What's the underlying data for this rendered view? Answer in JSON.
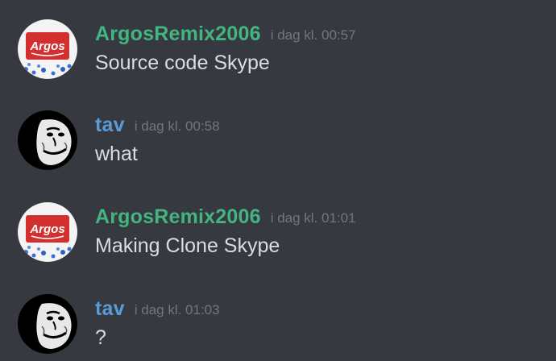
{
  "messages": [
    {
      "author": "ArgosRemix2006",
      "avatar_icon": "argos-logo-avatar",
      "avatar_text": "Argos",
      "name_color": "#43b581",
      "timestamp": "i dag kl. 00:57",
      "text": "Source code Skype"
    },
    {
      "author": "tav",
      "avatar_icon": "troll-face-avatar",
      "name_color": "#5a9bd8",
      "timestamp": "i dag kl. 00:58",
      "text": "what"
    },
    {
      "author": "ArgosRemix2006",
      "avatar_icon": "argos-logo-avatar",
      "avatar_text": "Argos",
      "name_color": "#43b581",
      "timestamp": "i dag kl. 01:01",
      "text": "Making Clone Skype"
    },
    {
      "author": "tav",
      "avatar_icon": "troll-face-avatar",
      "name_color": "#5a9bd8",
      "timestamp": "i dag kl. 01:03",
      "text": "?"
    }
  ],
  "colors": {
    "background": "#36393f",
    "message_text": "#dcddde",
    "timestamp": "#72767d",
    "argos_red": "#d32f2f"
  }
}
